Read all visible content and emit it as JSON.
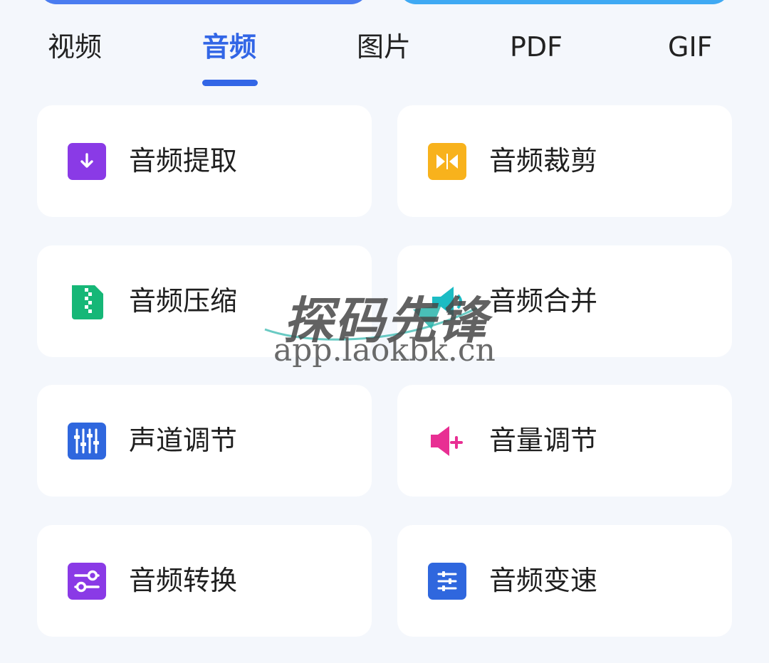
{
  "tabs": [
    {
      "label": "视频",
      "active": false
    },
    {
      "label": "音频",
      "active": true
    },
    {
      "label": "图片",
      "active": false
    },
    {
      "label": "PDF",
      "active": false
    },
    {
      "label": "GIF",
      "active": false
    }
  ],
  "tools": [
    {
      "label": "音频提取",
      "icon": "download-icon",
      "color": "#8a3ae6"
    },
    {
      "label": "音频裁剪",
      "icon": "trim-icon",
      "color": "#f8b21c"
    },
    {
      "label": "音频压缩",
      "icon": "zip-file-icon",
      "color": "#16b777"
    },
    {
      "label": "音频合并",
      "icon": "merge-speaker-icon",
      "color": "#1bbcc4"
    },
    {
      "label": "声道调节",
      "icon": "equalizer-icon",
      "color": "#2f67de"
    },
    {
      "label": "音量调节",
      "icon": "volume-plus-icon",
      "color": "#e82f93"
    },
    {
      "label": "音频转换",
      "icon": "convert-sliders-icon",
      "color": "#8a3ae6"
    },
    {
      "label": "音频变速",
      "icon": "speed-sliders-icon",
      "color": "#2f67de"
    }
  ],
  "colors": {
    "accent": "#3266e6",
    "background": "#f4f7fc",
    "card": "#ffffff",
    "top_button_left": "#4a7cf0",
    "top_button_right": "#3fa9f3"
  },
  "watermark": {
    "title": "探码先锋",
    "url": "app.laokbk.cn"
  }
}
